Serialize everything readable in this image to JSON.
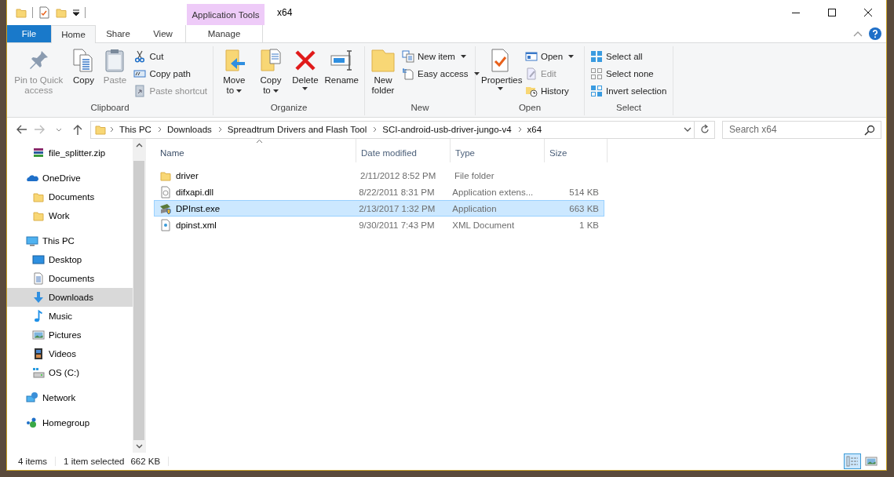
{
  "title_bar": {
    "title": "x64",
    "contextual_tab": "Application Tools"
  },
  "ribbon_tabs": [
    {
      "label": "File",
      "kind": "file",
      "selected": false
    },
    {
      "label": "Home",
      "kind": "normal",
      "selected": true
    },
    {
      "label": "Share",
      "kind": "normal",
      "selected": false
    },
    {
      "label": "View",
      "kind": "normal",
      "selected": false
    },
    {
      "label": "Manage",
      "kind": "contextual",
      "selected": false
    }
  ],
  "ribbon_groups": [
    {
      "label": "Clipboard",
      "items": [
        {
          "kind": "large",
          "label": "Pin to Quick access",
          "disabled": true
        },
        {
          "kind": "large",
          "label": "Copy",
          "disabled": false
        },
        {
          "kind": "large",
          "label": "Paste",
          "disabled": true
        },
        {
          "kind": "column",
          "items": [
            {
              "label": "Cut",
              "disabled": false
            },
            {
              "label": "Copy path",
              "disabled": false
            },
            {
              "label": "Paste shortcut",
              "disabled": true
            }
          ]
        }
      ]
    },
    {
      "label": "Organize",
      "items": [
        {
          "kind": "large",
          "label": "Move to",
          "disabled": false,
          "dropdown": true
        },
        {
          "kind": "large",
          "label": "Copy to",
          "disabled": false,
          "dropdown": true
        },
        {
          "kind": "large",
          "label": "Delete",
          "disabled": false,
          "dropdown": true
        },
        {
          "kind": "large",
          "label": "Rename",
          "disabled": false
        }
      ]
    },
    {
      "label": "New",
      "items": [
        {
          "kind": "large",
          "label": "New folder",
          "disabled": false
        },
        {
          "kind": "column",
          "items": [
            {
              "label": "New item",
              "disabled": false,
              "dropdown": true
            },
            {
              "label": "Easy access",
              "disabled": false,
              "dropdown": true
            }
          ]
        }
      ]
    },
    {
      "label": "Open",
      "items": [
        {
          "kind": "large",
          "label": "Properties",
          "disabled": false,
          "dropdown": true
        },
        {
          "kind": "column",
          "items": [
            {
              "label": "Open",
              "disabled": false,
              "dropdown": true
            },
            {
              "label": "Edit",
              "disabled": true
            },
            {
              "label": "History",
              "disabled": false
            }
          ]
        }
      ]
    },
    {
      "label": "Select",
      "items": [
        {
          "kind": "column",
          "items": [
            {
              "label": "Select all",
              "disabled": false
            },
            {
              "label": "Select none",
              "disabled": false
            },
            {
              "label": "Invert selection",
              "disabled": false
            }
          ]
        }
      ]
    }
  ],
  "address_bar": {
    "breadcrumbs": [
      "This PC",
      "Downloads",
      "Spreadtrum Drivers and Flash Tool",
      "SCI-android-usb-driver-jungo-v4",
      "x64"
    ]
  },
  "search": {
    "placeholder": "Search x64"
  },
  "nav_pane": {
    "scrolled_items": [
      {
        "label": "file_splitter.zip",
        "selected": false
      }
    ],
    "items": [
      {
        "label": "OneDrive",
        "selected": false,
        "children": [
          {
            "label": "Documents",
            "selected": false
          },
          {
            "label": "Work",
            "selected": false
          }
        ]
      },
      {
        "label": "This PC",
        "selected": false,
        "children": [
          {
            "label": "Desktop",
            "selected": false
          },
          {
            "label": "Documents",
            "selected": false
          },
          {
            "label": "Downloads",
            "selected": true
          },
          {
            "label": "Music",
            "selected": false
          },
          {
            "label": "Pictures",
            "selected": false
          },
          {
            "label": "Videos",
            "selected": false
          },
          {
            "label": "OS (C:)",
            "selected": false
          }
        ]
      },
      {
        "label": "Network",
        "selected": false
      },
      {
        "label": "Homegroup",
        "selected": false
      }
    ]
  },
  "table": {
    "columns": [
      {
        "label": "Name",
        "sorted": true
      },
      {
        "label": "Date modified",
        "sorted": false
      },
      {
        "label": "Type",
        "sorted": false
      },
      {
        "label": "Size",
        "sorted": false
      }
    ],
    "rows": [
      {
        "name": "driver",
        "kind": "folder",
        "date": "2/11/2012 8:52 PM",
        "type": "File folder",
        "selected": false
      },
      {
        "name": "difxapi.dll",
        "kind": "library",
        "date": "8/22/2011 8:31 PM",
        "type": "Application extens...",
        "size": "514 KB",
        "selected": false
      },
      {
        "name": "DPInst.exe",
        "kind": "program",
        "date": "2/13/2017 1:32 PM",
        "type": "Application",
        "size": "663 KB",
        "selected": true
      },
      {
        "name": "dpinst.xml",
        "kind": "markup",
        "date": "9/30/2011 7:43 PM",
        "type": "XML Document",
        "size": "1 KB",
        "selected": false
      }
    ]
  },
  "status_bar": {
    "item_count": "4 items",
    "selection": "1 item selected",
    "selection_size": "662 KB",
    "view_buttons": [
      {
        "kind": "details",
        "selected": true
      },
      {
        "kind": "large_icons",
        "selected": false
      }
    ]
  }
}
